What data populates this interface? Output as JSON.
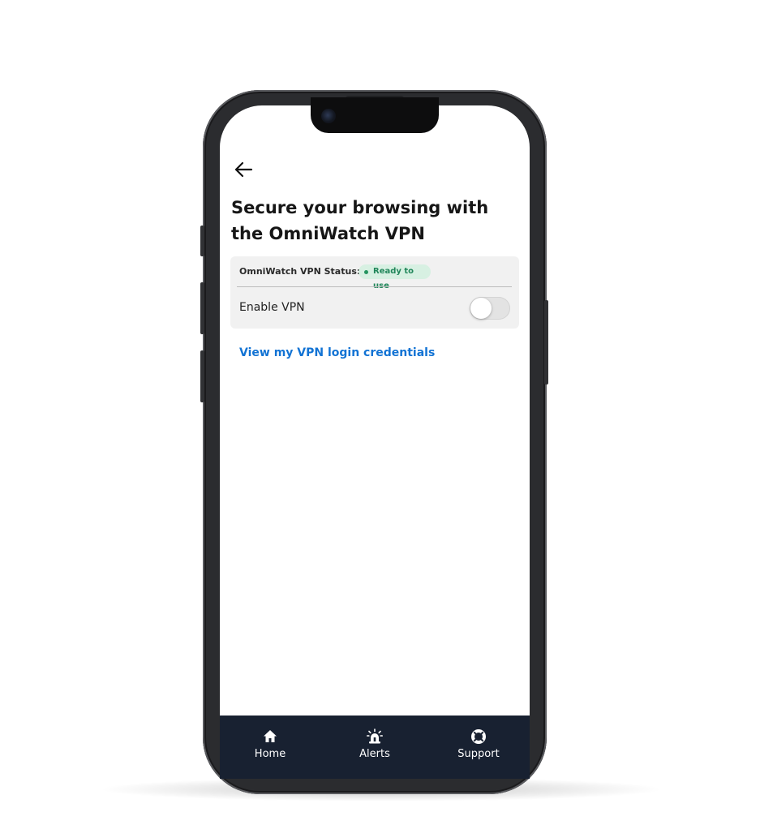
{
  "screen": {
    "title": "Secure your browsing with the OmniWatch VPN"
  },
  "vpn_card": {
    "status_label": "OmniWatch VPN Status:",
    "status_badge": "Ready to use",
    "enable_label": "Enable VPN",
    "enabled": false
  },
  "link": {
    "credentials": "View my VPN login credentials"
  },
  "nav": {
    "items": [
      {
        "label": "Home",
        "icon": "home-icon"
      },
      {
        "label": "Alerts",
        "icon": "siren-icon"
      },
      {
        "label": "Support",
        "icon": "lifebuoy-icon"
      }
    ]
  },
  "colors": {
    "accent_link": "#1273d4",
    "badge_bg": "#d7f0e2",
    "badge_text": "#21865a",
    "nav_bg": "#182131"
  }
}
